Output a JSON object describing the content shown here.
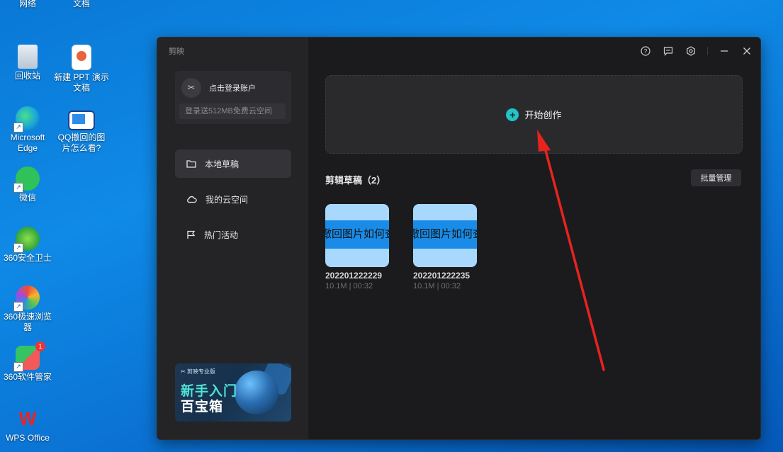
{
  "desktop": {
    "icons": [
      {
        "label": "网络"
      },
      {
        "label": "文档"
      },
      {
        "label": "回收站"
      },
      {
        "label": "新建 PPT 演示文稿"
      },
      {
        "label": "Microsoft Edge"
      },
      {
        "label": "QQ撤回的图片怎么看?"
      },
      {
        "label": "微信"
      },
      {
        "label": "360安全卫士"
      },
      {
        "label": "360极速浏览器"
      },
      {
        "label": "360软件管家",
        "badge": "1"
      },
      {
        "label": "WPS Office"
      }
    ]
  },
  "app": {
    "brand": "剪映",
    "account": {
      "login_label": "点击登录账户",
      "promo": "登录送512MB免费云空间"
    },
    "nav": [
      {
        "label": "本地草稿",
        "icon": "folder-icon",
        "active": true
      },
      {
        "label": "我的云空间",
        "icon": "cloud-icon",
        "active": false
      },
      {
        "label": "热门活动",
        "icon": "flag-icon",
        "active": false
      }
    ],
    "banner": {
      "small": "✂ 剪映专业版",
      "line1": "新手入门",
      "line2": "百宝箱"
    },
    "create_label": "开始创作",
    "drafts_title": "剪辑草稿（2）",
    "batch_label": "批量管理",
    "drafts": [
      {
        "thumb_text": "撤回图片如何查",
        "name": "202201222229",
        "meta": "10.1M | 00:32"
      },
      {
        "thumb_text": "撤回图片如何查",
        "name": "202201222235",
        "meta": "10.1M | 00:32"
      }
    ]
  },
  "colors": {
    "accent": "#22c3c9",
    "annotation_arrow": "#e8231f"
  }
}
